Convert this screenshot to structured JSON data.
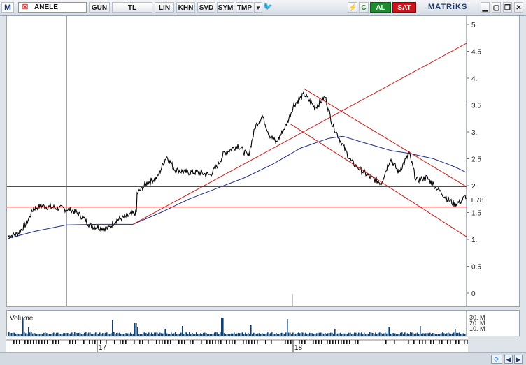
{
  "toolbar": {
    "logo_letter": "M",
    "symbol": "ANELE",
    "buttons": [
      "GUN",
      "TL",
      "LIN",
      "KHN",
      "SVD",
      "SYM",
      "TMP"
    ],
    "buy_label": "AL",
    "sell_label": "SAT",
    "brand": "MATRiKS",
    "accent_buy": "#1f8a2e",
    "accent_sell": "#c8141b"
  },
  "chart_data": {
    "type": "line",
    "title": "",
    "price_axis_labels": [
      "5.",
      "4.5",
      "4.",
      "3.5",
      "3.",
      "2.5",
      "2.",
      "1.5",
      "1.",
      "0.5",
      "0"
    ],
    "last_price_label": "1.78",
    "ylim": [
      0,
      5.1
    ],
    "x_period_labels": [
      "17",
      "18"
    ],
    "volume_label": "Volume",
    "volume_axis_labels": [
      "30. M",
      "20. M",
      "10. M"
    ],
    "price_series_color": "#000000",
    "moving_average_color": "#1b2a8a",
    "trendline_color": "#cc1a1a",
    "horizontal_levels": [
      1.98,
      1.6
    ],
    "volume_color": "#14406b"
  },
  "bottom": {
    "nav_prev": "◀",
    "nav_next": "▶"
  }
}
